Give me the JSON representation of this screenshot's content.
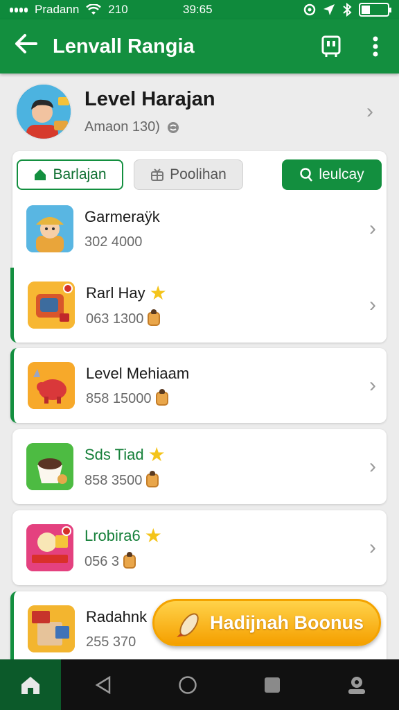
{
  "status_bar": {
    "carrier": "Pradann",
    "network": "210",
    "time": "39:65"
  },
  "app_bar": {
    "title": "Lenvall Rangia",
    "back_icon": "arrow-left-icon",
    "action_icon": "badge-icon",
    "menu_icon": "more-vert-icon"
  },
  "profile": {
    "name": "Level Harajan",
    "subtitle": "Amaon 130)"
  },
  "tabs": [
    {
      "label": "Barlajan",
      "icon": "home-icon"
    },
    {
      "label": "Poolihan",
      "icon": "gift-icon"
    },
    {
      "label": "leulcay",
      "icon": "search-icon"
    }
  ],
  "items": [
    {
      "name": "Garmeraÿk",
      "value": "302 4000",
      "star": false,
      "coin": false
    },
    {
      "name": "Rarl Hay",
      "value": "063 1300",
      "star": true,
      "coin": true
    },
    {
      "name": "Level Mehiaam",
      "value": "858 15000",
      "star": false,
      "coin": true
    },
    {
      "name": "Sds Tiad",
      "value": "858 3500",
      "star": true,
      "coin": true
    },
    {
      "name": "Lrobira6",
      "value": "056 3",
      "star": true,
      "coin": true
    },
    {
      "name": "Radahnk",
      "value": "255 370",
      "star": false,
      "coin": false
    }
  ],
  "bonus_button": {
    "label": "Hadijnah Boonus"
  },
  "colors": {
    "primary": "#138f3f",
    "accent": "#f5a000"
  }
}
